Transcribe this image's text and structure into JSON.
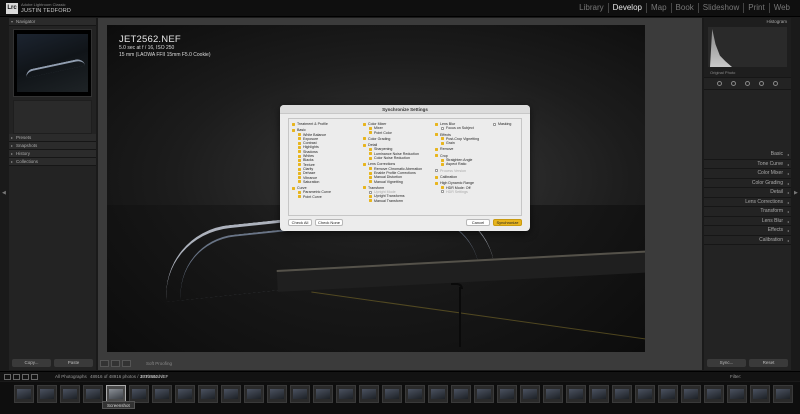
{
  "app": {
    "badge": "Lrc",
    "brand_small": "Adobe Lightroom Classic",
    "user_name": "JUSTIN TEDFORD"
  },
  "modules": [
    {
      "label": "Library",
      "active": false
    },
    {
      "label": "Develop",
      "active": true
    },
    {
      "label": "Map",
      "active": false
    },
    {
      "label": "Book",
      "active": false
    },
    {
      "label": "Slideshow",
      "active": false
    },
    {
      "label": "Print",
      "active": false
    },
    {
      "label": "Web",
      "active": false
    }
  ],
  "left_panel": {
    "navigator": "Navigator",
    "presets": "Presets",
    "snapshots": "Snapshots",
    "history": "History",
    "collections": "Collections",
    "copy_button": "Copy...",
    "paste_button": "Paste"
  },
  "photo": {
    "filename": "JET2562.NEF",
    "exif": "5.0 sec at f / 16, ISO 250",
    "lens": "15 mm (LAOWA FFII 15mm F5.0 Cookie)"
  },
  "dialog": {
    "title": "Synchronize Settings",
    "col1": [
      {
        "label": "Treatment & Profile",
        "level": 0,
        "checked": true
      },
      {
        "label": "Basic",
        "level": 0,
        "checked": true,
        "group": true
      },
      {
        "label": "White Balance",
        "level": 1,
        "checked": true
      },
      {
        "label": "Exposure",
        "level": 1,
        "checked": true
      },
      {
        "label": "Contrast",
        "level": 1,
        "checked": true
      },
      {
        "label": "Highlights",
        "level": 1,
        "checked": true
      },
      {
        "label": "Shadows",
        "level": 1,
        "checked": true
      },
      {
        "label": "Whites",
        "level": 1,
        "checked": true
      },
      {
        "label": "Blacks",
        "level": 1,
        "checked": true
      },
      {
        "label": "Texture",
        "level": 1,
        "checked": true
      },
      {
        "label": "Clarity",
        "level": 1,
        "checked": true
      },
      {
        "label": "Dehaze",
        "level": 1,
        "checked": true
      },
      {
        "label": "Vibrance",
        "level": 1,
        "checked": true
      },
      {
        "label": "Saturation",
        "level": 1,
        "checked": true
      },
      {
        "label": "Curve",
        "level": 0,
        "checked": true,
        "group": true
      },
      {
        "label": "Parametric Curve",
        "level": 1,
        "checked": true
      },
      {
        "label": "Point Curve",
        "level": 1,
        "checked": true
      }
    ],
    "col2": [
      {
        "label": "Color Mixer",
        "level": 0,
        "checked": true
      },
      {
        "label": "Mixer",
        "level": 1,
        "checked": true
      },
      {
        "label": "Point Color",
        "level": 1,
        "checked": true
      },
      {
        "label": "Color Grading",
        "level": 0,
        "checked": true,
        "group": true
      },
      {
        "label": "Detail",
        "level": 0,
        "checked": true,
        "group": true
      },
      {
        "label": "Sharpening",
        "level": 1,
        "checked": true
      },
      {
        "label": "Luminance Noise Reduction",
        "level": 1,
        "checked": true
      },
      {
        "label": "Color Noise Reduction",
        "level": 1,
        "checked": true
      },
      {
        "label": "Lens Corrections",
        "level": 0,
        "checked": true,
        "group": true
      },
      {
        "label": "Remove Chromatic Aberration",
        "level": 1,
        "checked": true
      },
      {
        "label": "Enable Profile Corrections",
        "level": 1,
        "checked": true
      },
      {
        "label": "Manual Distortion",
        "level": 1,
        "checked": true
      },
      {
        "label": "Manual Vignetting",
        "level": 1,
        "checked": true
      },
      {
        "label": "Transform",
        "level": 0,
        "checked": true,
        "group": true
      },
      {
        "label": "Upright Mode",
        "level": 1,
        "checked": false,
        "dim": true
      },
      {
        "label": "Upright Transforms",
        "level": 1,
        "checked": true
      },
      {
        "label": "Manual Transform",
        "level": 1,
        "checked": true
      }
    ],
    "col3": [
      {
        "label": "Lens Blur",
        "level": 0,
        "checked": true
      },
      {
        "label": "Focus on Subject",
        "level": 1,
        "checked": false,
        "dim": false
      },
      {
        "label": "Effects",
        "level": 0,
        "checked": true,
        "group": true
      },
      {
        "label": "Post-Crop Vignetting",
        "level": 1,
        "checked": true
      },
      {
        "label": "Grain",
        "level": 1,
        "checked": true
      },
      {
        "label": "Remove",
        "level": 0,
        "checked": true,
        "group": true
      },
      {
        "label": "Crop",
        "level": 0,
        "checked": true,
        "group": true
      },
      {
        "label": "Straighten Angle",
        "level": 1,
        "checked": true
      },
      {
        "label": "Aspect Ratio",
        "level": 1,
        "checked": true
      },
      {
        "label": "Process Version",
        "level": 0,
        "checked": false,
        "dim": true,
        "group": true
      },
      {
        "label": "Calibration",
        "level": 0,
        "checked": true,
        "group": true
      },
      {
        "label": "High Dynamic Range",
        "level": 0,
        "checked": true,
        "group": true
      },
      {
        "label": "HDR Mode: Off",
        "level": 1,
        "checked": true
      },
      {
        "label": "HDR Settings",
        "level": 1,
        "checked": false,
        "dim": true
      }
    ],
    "col4": [
      {
        "label": "Masking",
        "level": 0,
        "checked": false
      }
    ],
    "check_all": "Check All",
    "check_none": "Check None",
    "cancel": "Cancel",
    "synchronize": "Synchronize"
  },
  "right_panel": {
    "histogram": "Histogram",
    "original_photo": "Original Photo",
    "sections": [
      "Basic",
      "Tone Curve",
      "Color Mixer",
      "Color Grading",
      "Detail",
      "Lens Corrections",
      "Transform",
      "Lens Blur",
      "Effects",
      "Calibration"
    ],
    "sync_button": "Sync...",
    "reset_button": "Reset"
  },
  "canvas_toolbar": {
    "soft_proofing": "Soft Proofing"
  },
  "filmstrip_bar": {
    "source": "All Photographs",
    "count": "48916 of 48916 photos / 1 selected /",
    "file": "JET2562.NEF",
    "filter": "Filter:"
  },
  "filmstrip": {
    "selected_index": 4,
    "tooltip": "Screenshot",
    "thumb_count": 34
  },
  "colors": {
    "accent": "#e8b51d",
    "panel": "#232323",
    "canvas": "#3b3b3b"
  }
}
